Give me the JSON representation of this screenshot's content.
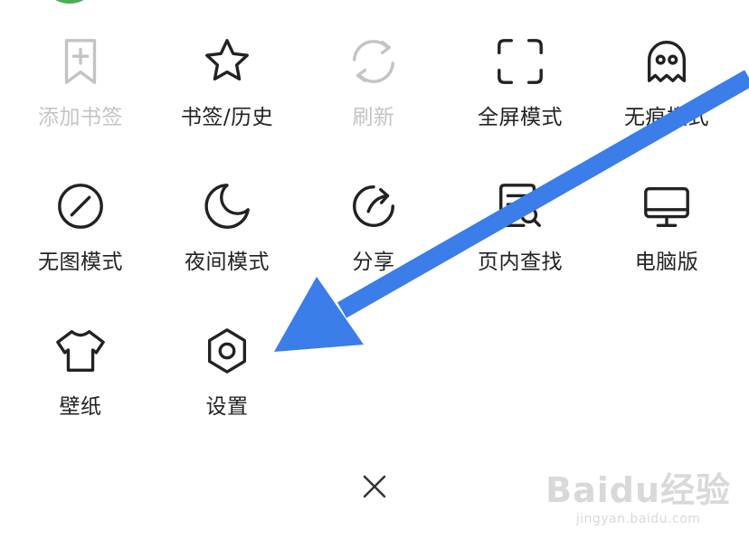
{
  "menu": {
    "row1": [
      {
        "label": "添加书签",
        "icon": "bookmark-add-icon",
        "disabled": true
      },
      {
        "label": "书签/历史",
        "icon": "star-icon",
        "disabled": false
      },
      {
        "label": "刷新",
        "icon": "refresh-icon",
        "disabled": true
      },
      {
        "label": "全屏模式",
        "icon": "fullscreen-icon",
        "disabled": false
      },
      {
        "label": "无痕模式",
        "icon": "ghost-icon",
        "disabled": false
      }
    ],
    "row2": [
      {
        "label": "无图模式",
        "icon": "no-image-icon"
      },
      {
        "label": "夜间模式",
        "icon": "moon-icon"
      },
      {
        "label": "分享",
        "icon": "share-icon"
      },
      {
        "label": "页内查找",
        "icon": "find-in-page-icon"
      },
      {
        "label": "电脑版",
        "icon": "desktop-icon"
      }
    ],
    "row3": [
      {
        "label": "壁纸",
        "icon": "tshirt-icon"
      },
      {
        "label": "设置",
        "icon": "settings-icon"
      }
    ]
  },
  "close_icon": "close-icon",
  "annotation_color": "#3b7de9",
  "watermark": {
    "main": "Baidu经验",
    "sub": "jingyan.baidu.com"
  }
}
